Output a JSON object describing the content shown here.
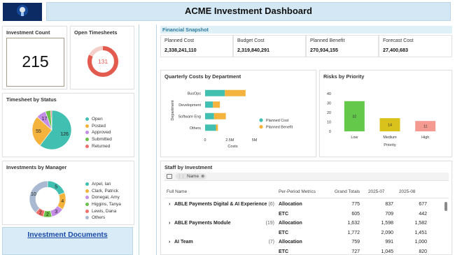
{
  "header": {
    "title": "ACME Investment Dashboard",
    "logo_icon": "lightbulb-icon"
  },
  "investment_count": {
    "title": "Investment Count",
    "value": "215"
  },
  "open_timesheets": {
    "title": "Open Timesheets",
    "value": "131",
    "fill_fraction": 0.82,
    "color": "#e35a4f"
  },
  "timesheet_status": {
    "title": "Timesheet by Status",
    "chart_data": {
      "type": "pie",
      "categories": [
        "Open",
        "Posted",
        "Approved",
        "Submitted",
        "Returned"
      ],
      "values": [
        126,
        55,
        17,
        9,
        2
      ],
      "colors": [
        "#41bfb0",
        "#f3b33d",
        "#c48ee7",
        "#6cc04a",
        "#ef6f6c"
      ],
      "slice_labels": [
        "126",
        "55",
        "17",
        "",
        ""
      ]
    }
  },
  "investments_by_manager": {
    "title": "Investments by Manager",
    "chart_data": {
      "type": "pie",
      "categories": [
        "Arpel, Ian",
        "Clark, Patrick",
        "Donegal, Amy",
        "Higgins, Tanya",
        "Lewis, Dana",
        "Others"
      ],
      "values": [
        5,
        4,
        3,
        2,
        2,
        10
      ],
      "colors": [
        "#41bfb0",
        "#f3b33d",
        "#c48ee7",
        "#6cc04a",
        "#ef6f6c",
        "#a9b9d1"
      ]
    }
  },
  "documents": {
    "link_label": "Investment Documents"
  },
  "financial_snapshot": {
    "title": "Financial Snapshot",
    "metrics": [
      {
        "label": "Planned Cost",
        "value": "2,338,241,110"
      },
      {
        "label": "Budget Cost",
        "value": "2,319,840,291"
      },
      {
        "label": "Planned Benefit",
        "value": "270,934,155"
      },
      {
        "label": "Forecast Cost",
        "value": "27,400,683"
      }
    ]
  },
  "quarterly_costs": {
    "title": "Quarterly Costs by Department",
    "chart_data": {
      "type": "bar",
      "orientation": "horizontal",
      "stacked": true,
      "categories": [
        "BusOps",
        "Development",
        "Software Eng",
        "Others"
      ],
      "series": [
        {
          "name": "Planned Cost",
          "values": [
            2000000,
            800000,
            900000,
            1100000
          ],
          "color": "#41bfb0"
        },
        {
          "name": "Planned Benefit",
          "values": [
            2100000,
            700000,
            1200000,
            200000
          ],
          "color": "#f3b33d"
        }
      ],
      "xlim": [
        0,
        5600000
      ],
      "xticks": [
        {
          "v": 0,
          "t": "0"
        },
        {
          "v": 2500000,
          "t": "2.5M"
        },
        {
          "v": 5000000,
          "t": "5M"
        }
      ],
      "xlabel": "Costs",
      "ylabel": "Department",
      "legend": "right"
    }
  },
  "risks_by_priority": {
    "title": "Risks by Priority",
    "chart_data": {
      "type": "bar",
      "categories": [
        "Low",
        "Medium",
        "High"
      ],
      "values": [
        32,
        14,
        11
      ],
      "colors": [
        "#64c84a",
        "#d9c21c",
        "#f49a90"
      ],
      "ylim": [
        0,
        40
      ],
      "yticks": [
        0,
        10,
        20,
        30,
        40
      ],
      "xlabel": "Priority",
      "data_labels": [
        "32",
        "14",
        "11"
      ]
    }
  },
  "staff_by_investment": {
    "title": "Staff by Investment",
    "group_chip": "Name",
    "columns": [
      "Full Name",
      "Per-Period Metrics",
      "Grand Totals",
      "2025-07",
      "2025-08"
    ],
    "groups": [
      {
        "name": "ABLE Payments Digital & AI Experience",
        "count": "(6)",
        "rows": [
          {
            "metric": "Allocation",
            "grand": "775",
            "p1": "837",
            "p2": "677"
          },
          {
            "metric": "ETC",
            "grand": "605",
            "p1": "709",
            "p2": "442"
          }
        ]
      },
      {
        "name": "ABLE Payments Module",
        "count": "(19)",
        "rows": [
          {
            "metric": "Allocation",
            "grand": "1,632",
            "p1": "1,598",
            "p2": "1,582"
          },
          {
            "metric": "ETC",
            "grand": "1,772",
            "p1": "2,090",
            "p2": "1,451"
          }
        ]
      },
      {
        "name": "AI Team",
        "count": "(7)",
        "rows": [
          {
            "metric": "Allocation",
            "grand": "759",
            "p1": "991",
            "p2": "1,000"
          },
          {
            "metric": "ETC",
            "grand": "727",
            "p1": "1,045",
            "p2": "820"
          }
        ]
      }
    ]
  }
}
